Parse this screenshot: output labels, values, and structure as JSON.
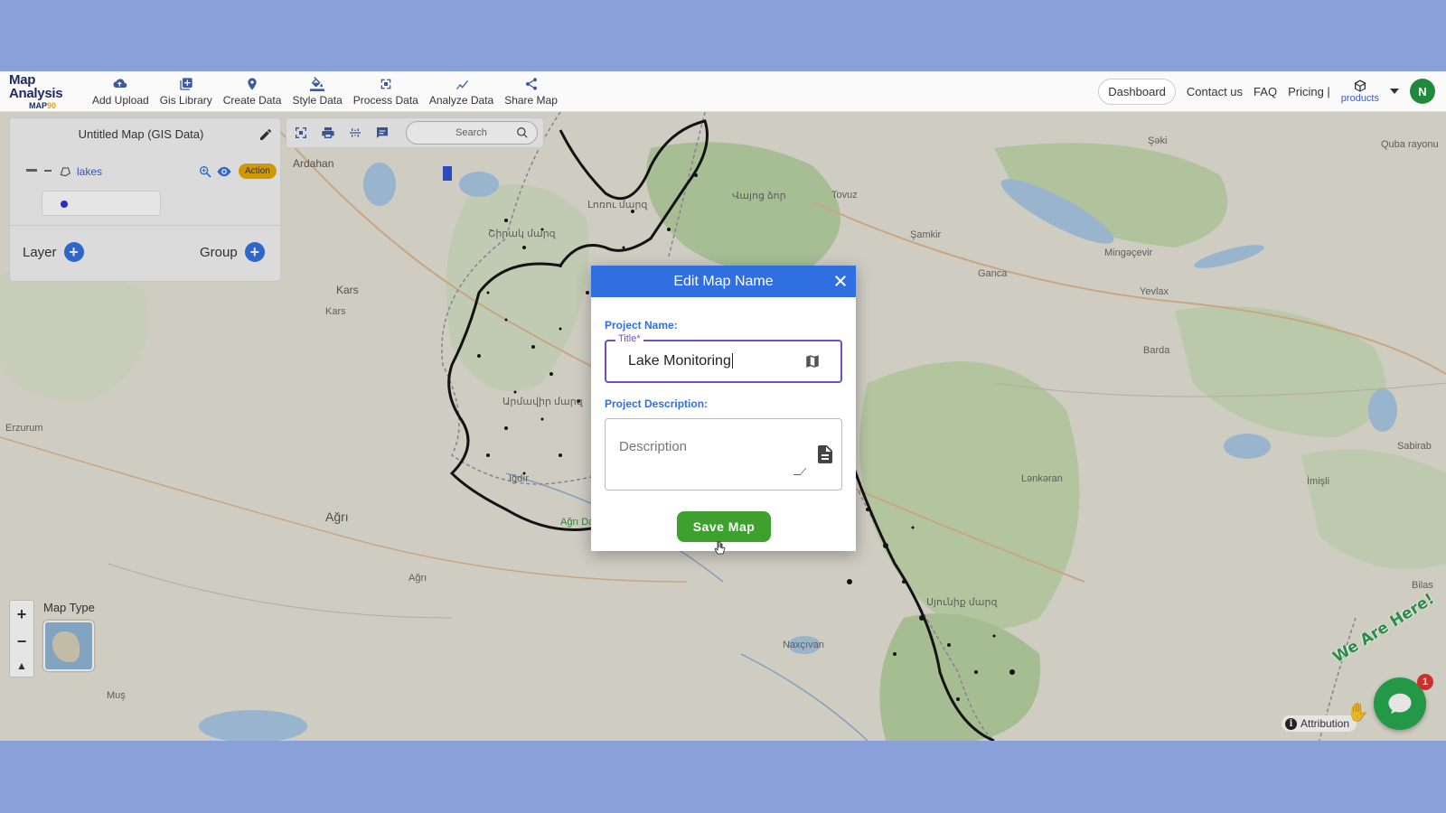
{
  "app": {
    "logo_line1": "Map Analysis",
    "logo_line2_a": "MAP",
    "logo_line2_b": "90"
  },
  "nav": {
    "items": [
      {
        "label": "Add Upload",
        "icon": "cloud-upload-icon"
      },
      {
        "label": "Gis Library",
        "icon": "library-icon"
      },
      {
        "label": "Create Data",
        "icon": "map-pin-icon"
      },
      {
        "label": "Style Data",
        "icon": "paint-bucket-icon"
      },
      {
        "label": "Process Data",
        "icon": "process-icon"
      },
      {
        "label": "Analyze Data",
        "icon": "analyze-icon"
      },
      {
        "label": "Share Map",
        "icon": "share-icon"
      }
    ],
    "dashboard": "Dashboard",
    "contact": "Contact us",
    "faq": "FAQ",
    "pricing": "Pricing |",
    "products": "products",
    "avatar_initial": "N"
  },
  "layer_panel": {
    "title": "Untitled Map (GIS Data)",
    "layer_name": "lakes",
    "action_label": "Action",
    "layer_add_label": "Layer",
    "group_add_label": "Group"
  },
  "toolbar": {
    "search_placeholder": "Search"
  },
  "map": {
    "places": [
      "Ardahan",
      "Kars",
      "Kars",
      "Erzurum",
      "Ağrı",
      "Ağrı",
      "Iğdır",
      "Tovuz",
      "Şamkir",
      "Ganca",
      "Mingəçevir",
      "Yevlax",
      "Barda",
      "Şəki",
      "Quba rayonu",
      "Sabirab",
      "İmişli",
      "Bilas",
      "Naxçıvan",
      "Muş",
      "Lənkəran",
      "Ağrı Dağı Milli P",
      "Սյունիք մարզ",
      "Լոռու մարզ",
      "Շիրակ մարզ",
      "Արմավիր մարզ",
      "Վայոց ձոր"
    ],
    "map_type_label": "Map Type",
    "attribution": "Attribution",
    "chat_banner": "We Are Here!",
    "chat_count": "1"
  },
  "modal": {
    "title": "Edit Map Name",
    "project_name_label": "Project Name:",
    "title_legend": "Title*",
    "title_value": "Lake Monitoring",
    "description_label": "Project Description:",
    "description_placeholder": "Description",
    "save_label": "Save Map"
  },
  "colors": {
    "background": "#8aa0d8",
    "primary": "#2f6fe0",
    "save_green": "#3ea02e",
    "focus_purple": "#7a4bc8",
    "action_badge": "#e8a800"
  }
}
